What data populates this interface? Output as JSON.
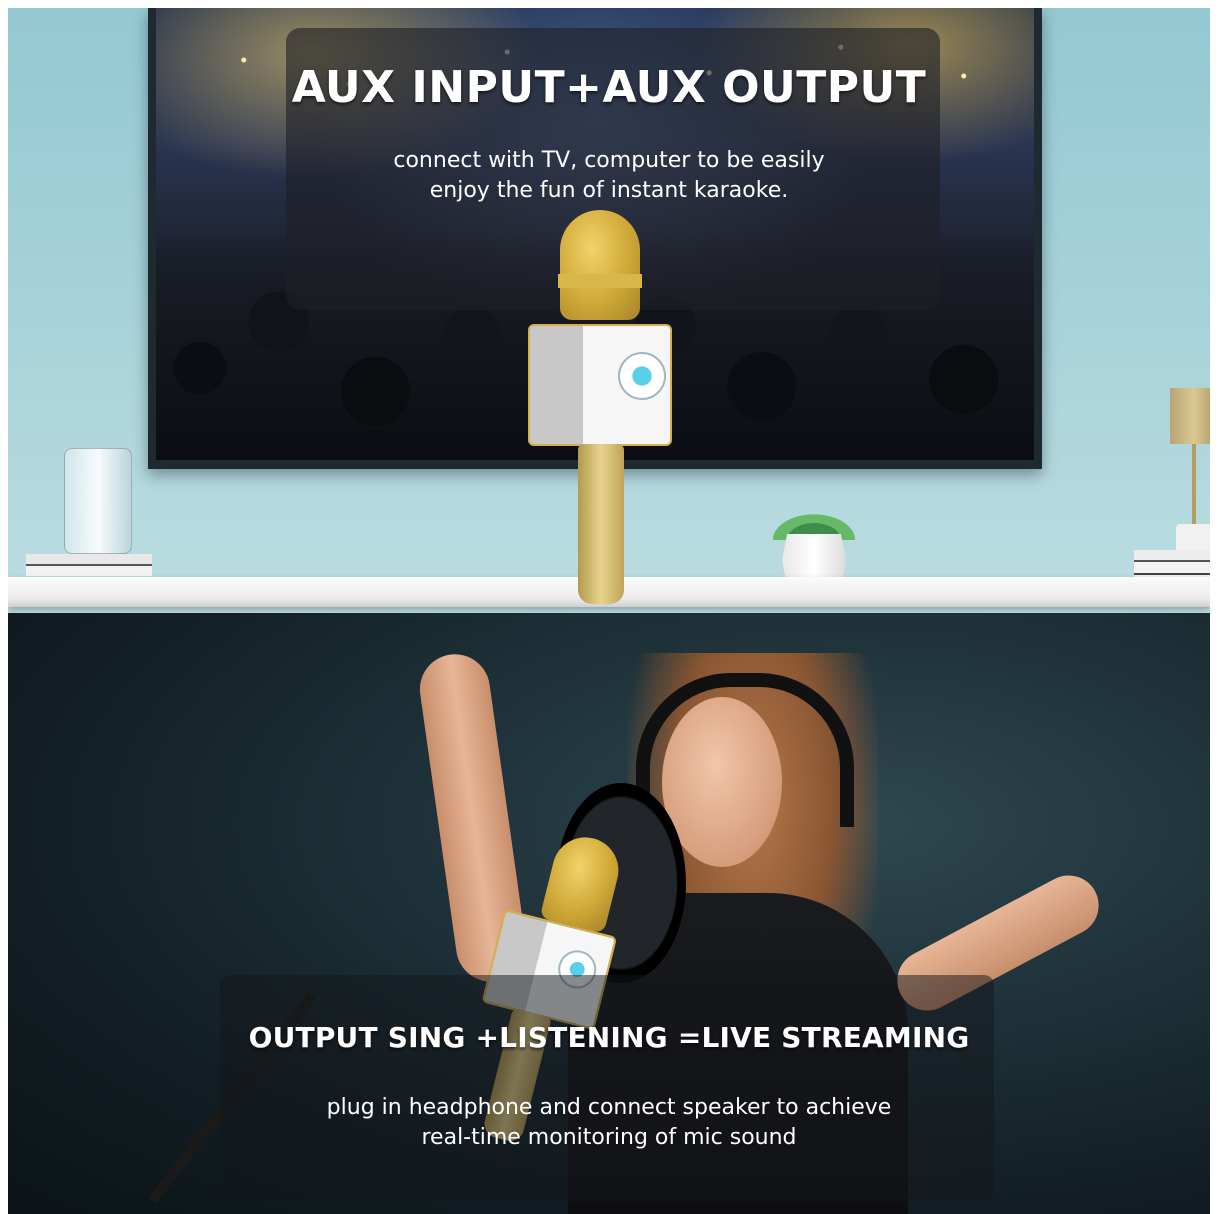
{
  "top_section": {
    "title": "AUX INPUT+AUX OUTPUT",
    "subtitle_line1": "connect with TV, computer to be easily",
    "subtitle_line2": "enjoy the fun of instant karaoke."
  },
  "bottom_section": {
    "title": "OUTPUT SING +LISTENING =LIVE STREAMING",
    "subtitle_line1": "plug in headphone and connect speaker to achieve",
    "subtitle_line2": "real-time monitoring of mic sound"
  },
  "colors": {
    "wall": "#a9d3da",
    "mic_gold": "#cfa837",
    "studio_background": "#1f323a",
    "text": "#ffffff"
  },
  "icons": [
    "tv-icon",
    "microphone-icon",
    "headphones-icon",
    "pop-filter-icon"
  ]
}
